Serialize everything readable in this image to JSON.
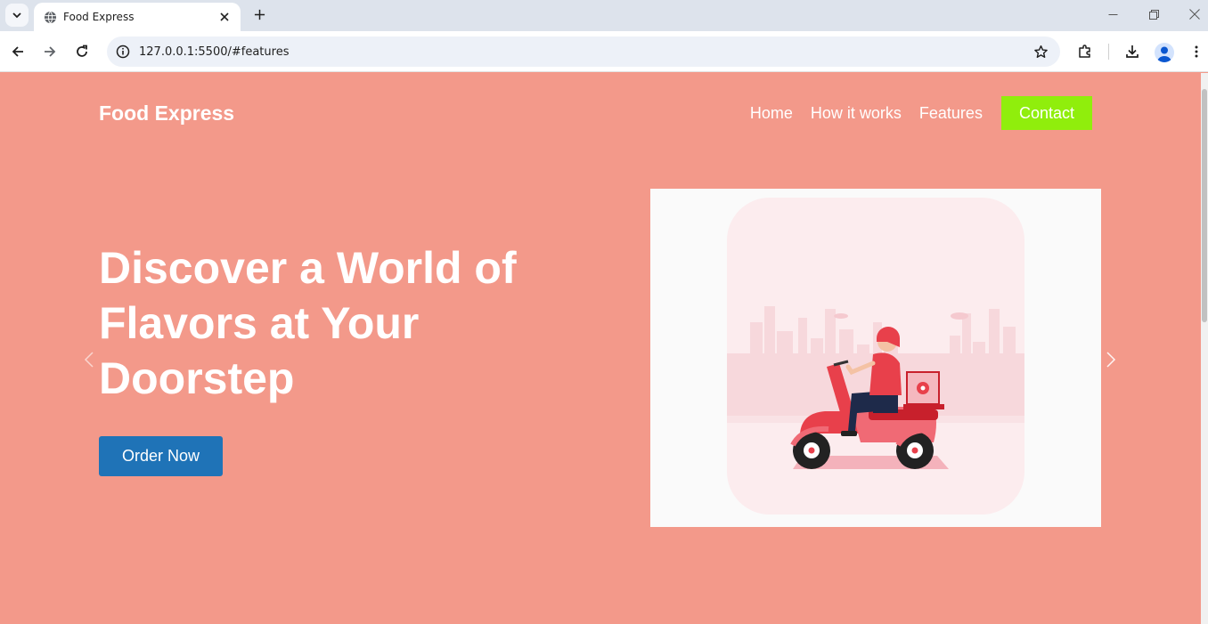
{
  "browser": {
    "tab_title": "Food Express",
    "url": "127.0.0.1:5500/#features"
  },
  "site": {
    "brand": "Food Express",
    "nav": [
      {
        "label": "Home"
      },
      {
        "label": "How it works"
      },
      {
        "label": "Features"
      }
    ],
    "contact_label": "Contact",
    "hero_title": "Discover a World of Flavors at Your Doorstep",
    "order_button": "Order Now"
  },
  "colors": {
    "page_background": "#f3998a",
    "contact_button": "#90ee0c",
    "order_button": "#1f73b7",
    "image_frame": "#fafafa"
  },
  "icons": {
    "tab_favicon": "globe-icon",
    "carousel_prev": "chevron-left-icon",
    "carousel_next": "chevron-right-icon",
    "hero_image": "delivery-scooter-illustration"
  }
}
